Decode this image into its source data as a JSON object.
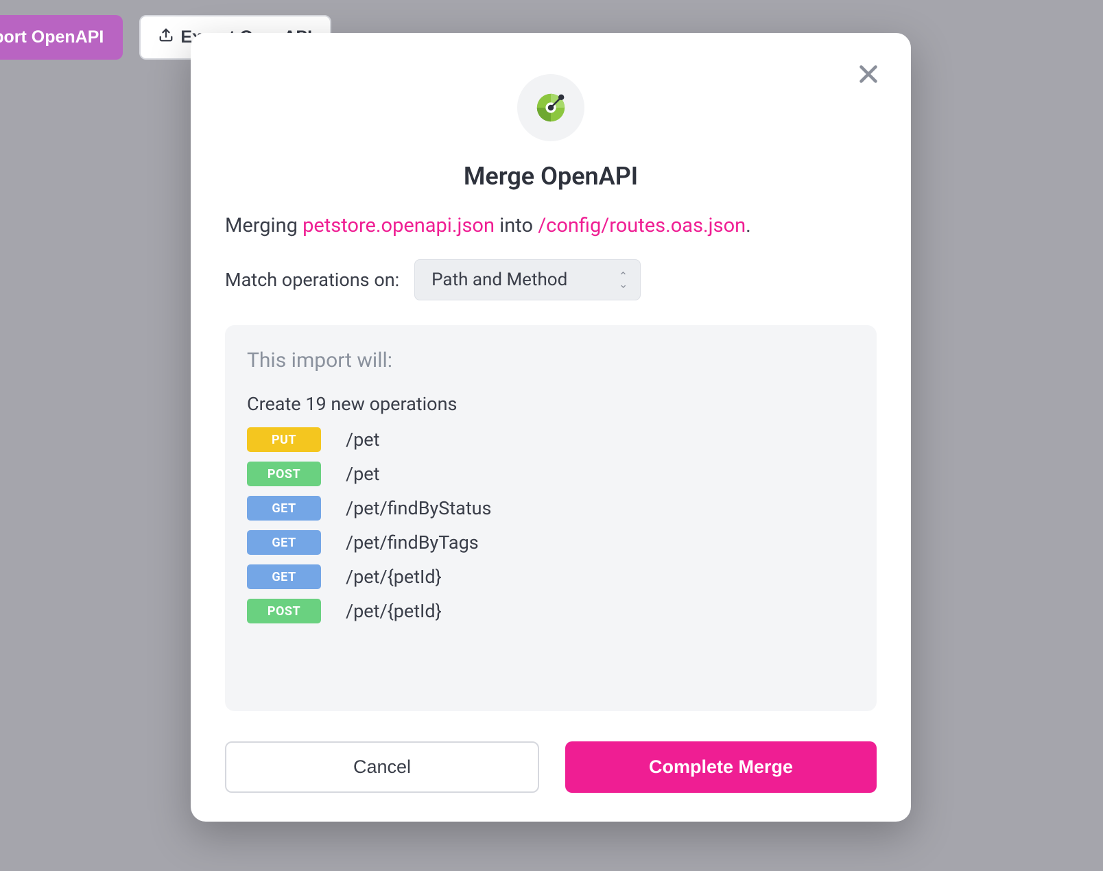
{
  "background": {
    "import_label": "mport OpenAPI",
    "export_label": "Export OpenAPI"
  },
  "modal": {
    "title": "Merge OpenAPI",
    "desc_prefix": "Merging ",
    "source_file": "petstore.openapi.json",
    "desc_middle": " into ",
    "target_file": "/config/routes.oas.json",
    "desc_suffix": ".",
    "match_label": "Match operations on:",
    "match_value": "Path and Method",
    "panel_header": "This import will:",
    "create_line": "Create 19 new operations",
    "operations": [
      {
        "method": "PUT",
        "color": "#f4c61f",
        "path": "/pet"
      },
      {
        "method": "POST",
        "color": "#6ad180",
        "path": "/pet"
      },
      {
        "method": "GET",
        "color": "#74a6e6",
        "path": "/pet/findByStatus"
      },
      {
        "method": "GET",
        "color": "#74a6e6",
        "path": "/pet/findByTags"
      },
      {
        "method": "GET",
        "color": "#74a6e6",
        "path": "/pet/{petId}"
      },
      {
        "method": "POST",
        "color": "#6ad180",
        "path": "/pet/{petId}"
      }
    ],
    "cancel_label": "Cancel",
    "complete_label": "Complete Merge"
  }
}
